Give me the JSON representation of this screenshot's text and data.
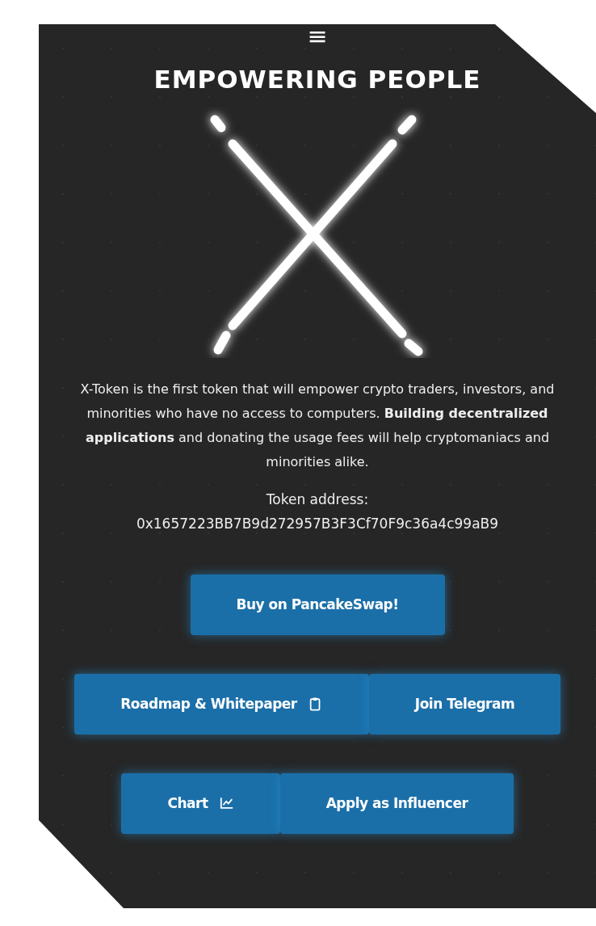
{
  "menu_icon": "≡",
  "title": "EMPOWERING PEOPLE",
  "description": "X-Token is the first token that will empower crypto traders, investors, and minorities who have no access to computers. **Building decentralized applications** and donating the usage fees will help cryptomaniacs and minorities alike.",
  "token_address_label": "Token address:",
  "token_address": "0x1657223BB7B9d272957B3F3Cf70F9c36a4c99aB9",
  "button_rows": [
    [
      {
        "label": "Buy on PancakeSwap!",
        "kind": "plain"
      }
    ],
    [
      {
        "label": "Roadmap & Whitepaper",
        "kind": "clipboard"
      },
      {
        "label": "Join Telegram",
        "kind": "plain"
      }
    ],
    [
      {
        "label": "Chart",
        "kind": "chart"
      },
      {
        "label": "Apply as Influencer",
        "kind": "plain"
      }
    ]
  ]
}
